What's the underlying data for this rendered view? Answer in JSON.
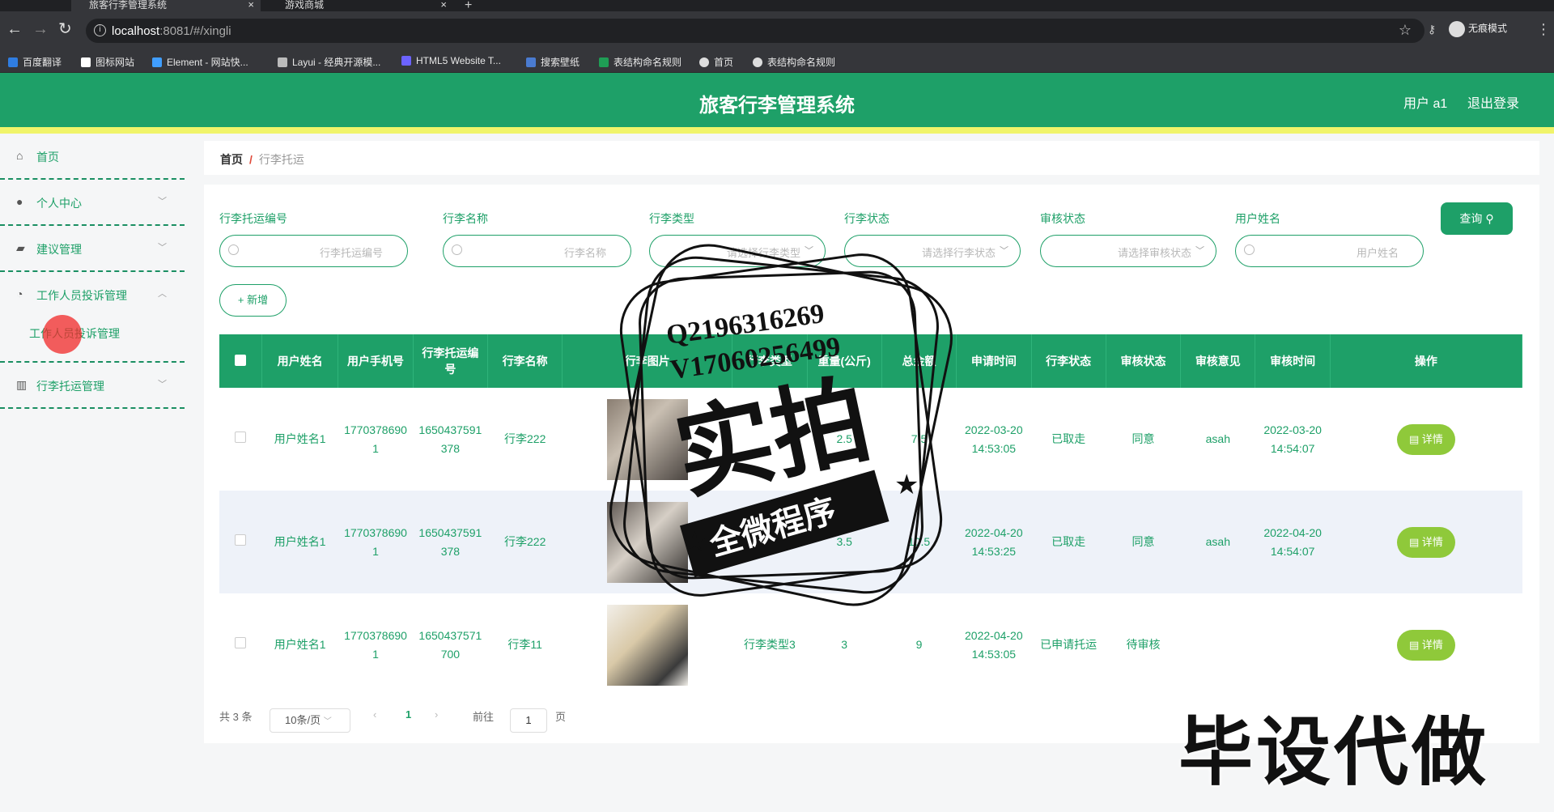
{
  "browser": {
    "tabs": [
      {
        "label": "旅客行李管理系统",
        "active": true
      },
      {
        "label": "游戏商城",
        "active": false
      }
    ],
    "url_host": "localhost",
    "url_rest": ":8081/#/xingli",
    "incognito_label": "无痕模式",
    "bookmarks": [
      {
        "label": "百度翻译",
        "color": "#2f7de1"
      },
      {
        "label": "图标网站",
        "color": "#ffffff"
      },
      {
        "label": "Element - 网站快...",
        "color": "#409eff"
      },
      {
        "label": "Layui - 经典开源模...",
        "color": "#bbbbbb"
      },
      {
        "label": "HTML5 Website T...",
        "color": "#6c63ff"
      },
      {
        "label": "搜索壁纸",
        "color": "#4a7bd0"
      },
      {
        "label": "表结构命名规则",
        "color": "#1f9d55"
      },
      {
        "label": "首页",
        "color": "#dddddd"
      },
      {
        "label": "表结构命名规则",
        "color": "#dddddd"
      }
    ]
  },
  "header": {
    "title": "旅客行李管理系统",
    "user": "用户 a1",
    "logout": "退出登录",
    "brand_color": "#1ea068"
  },
  "sidebar": {
    "items": [
      {
        "label": "首页",
        "icon": "home-icon",
        "glyph": "⌂",
        "has_arrow": false,
        "arrow": ""
      },
      {
        "label": "个人中心",
        "icon": "user-icon",
        "glyph": "●",
        "has_arrow": true,
        "arrow": "﹀"
      },
      {
        "label": "建议管理",
        "icon": "suggestion-icon",
        "glyph": "▰",
        "has_arrow": true,
        "arrow": "﹀"
      },
      {
        "label": "工作人员投诉管理",
        "icon": "complaint-icon",
        "glyph": "◔",
        "has_arrow": true,
        "arrow": "︿"
      },
      {
        "label": "行李托运管理",
        "icon": "luggage-icon",
        "glyph": "▥",
        "has_arrow": true,
        "arrow": "﹀"
      }
    ],
    "sub_item": "工作人员投诉管理"
  },
  "breadcrumb": {
    "home": "首页",
    "separator": "/",
    "current": "行李托运"
  },
  "filters": [
    {
      "label": "行李托运编号",
      "placeholder": "行李托运编号",
      "type": "input"
    },
    {
      "label": "行李名称",
      "placeholder": "行李名称",
      "type": "input"
    },
    {
      "label": "行李类型",
      "placeholder": "请选择行李类型",
      "type": "select"
    },
    {
      "label": "行李状态",
      "placeholder": "请选择行李状态",
      "type": "select"
    },
    {
      "label": "审核状态",
      "placeholder": "请选择审核状态",
      "type": "select"
    },
    {
      "label": "用户姓名",
      "placeholder": "用户姓名",
      "type": "input"
    }
  ],
  "buttons": {
    "query": "查询",
    "add": "+ 新增",
    "detail": "详情"
  },
  "table": {
    "columns": [
      "用户姓名",
      "用户手机号",
      "行李托运编号",
      "行李名称",
      "行李图片",
      "行李类型",
      "重量(公斤)",
      "总金额",
      "申请时间",
      "行李状态",
      "审核状态",
      "审核意见",
      "审核时间",
      "操作"
    ],
    "rows": [
      {
        "user": "用户姓名1",
        "phone": "17703786901",
        "code": "1650437591378",
        "name": "行李222",
        "type": "",
        "weight": "2.5",
        "amount": "7.5",
        "apply_time": "2022-03-20 14:53:05",
        "status": "已取走",
        "review": "同意",
        "opinion": "asah",
        "review_time": "2022-03-20 14:54:07"
      },
      {
        "user": "用户姓名1",
        "phone": "17703786901",
        "code": "1650437591378",
        "name": "行李222",
        "type": "",
        "weight": "3.5",
        "amount": "10.5",
        "apply_time": "2022-04-20 14:53:25",
        "status": "已取走",
        "review": "同意",
        "opinion": "asah",
        "review_time": "2022-04-20 14:54:07"
      },
      {
        "user": "用户姓名1",
        "phone": "17703786901",
        "code": "1650437571700",
        "name": "行李11",
        "type": "行李类型3",
        "weight": "3",
        "amount": "9",
        "apply_time": "2022-04-20 14:53:05",
        "status": "已申请托运",
        "review": "待审核",
        "opinion": "",
        "review_time": ""
      }
    ]
  },
  "pagination": {
    "total": "共 3 条",
    "page_size": "10条/页",
    "current_page": "1",
    "goto_label": "前往",
    "goto_value": "1",
    "page_unit": "页",
    "prev": "‹",
    "next": "›"
  },
  "overlay": {
    "stamp_line1": "Q2196316269",
    "stamp_line2": "V17060256499",
    "stamp_main": "实拍",
    "stamp_banner": "全微程序",
    "watermark": "毕设代做"
  }
}
